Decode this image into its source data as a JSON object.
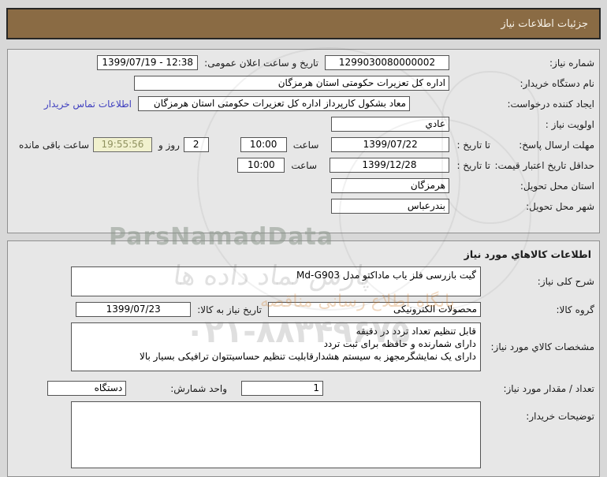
{
  "titlebar": {
    "title": "جزئیات اطلاعات نیاز"
  },
  "watermark": {
    "brand": "ParsNamadData",
    "calligraphy": "پارس نماد داده ها",
    "slogan": "پایگاه اطلاع رسانی مناقصه",
    "phone": "۰۲۱-۸۸۳۴۹۶۷۵"
  },
  "need_info": {
    "need_number": {
      "label": "شماره نیاز:",
      "value": "1299030080000002"
    },
    "announce_datetime": {
      "label": "تاریخ و ساعت اعلان عمومی:",
      "value": "1399/07/19 - 12:38"
    },
    "buyer_org": {
      "label": "نام دستگاه خریدار:",
      "value": "اداره کل تعزیرات حکومتی استان هرمزگان"
    },
    "request_creator": {
      "label": "ایجاد کننده درخواست:",
      "value": "معاد بشکول کارپرداز اداره کل تعزیرات حکومتی استان هرمزگان",
      "contact_link": "اطلاعات تماس خریدار"
    },
    "priority": {
      "label": "اولویت نیاز :",
      "value": "عادي"
    },
    "reply_deadline": {
      "label": "مهلت ارسال پاسخ:",
      "until_label": "تا تاریخ :",
      "date": "1399/07/22",
      "hour_label": "ساعت",
      "time": "10:00",
      "days_value": "2",
      "days_label": "روز و",
      "countdown": "19:55:56",
      "remaining_label": "ساعت باقی مانده"
    },
    "price_validity": {
      "label": "حداقل تاریخ اعتبار قیمت:",
      "until_label": "تا تاریخ :",
      "date": "1399/12/28",
      "hour_label": "ساعت",
      "time": "10:00"
    },
    "delivery_province": {
      "label": "استان محل تحویل:",
      "value": "هرمزگان"
    },
    "delivery_city": {
      "label": "شهر محل تحویل:",
      "value": "بندرعباس"
    }
  },
  "goods_info": {
    "section_title": "اطلاعات کالاهاي مورد نیاز",
    "general_desc": {
      "label": "شرح کلی نیاز:",
      "value": "گیت بازرسی فلز یاب ماداکتو مدل Md-G903"
    },
    "goods_group": {
      "label": "گروه کالا:",
      "value": "محصولات الکترونیکی"
    },
    "need_date": {
      "label": "تاریخ نیاز به کالا:",
      "value": "1399/07/23"
    },
    "specs": {
      "label": "مشخصات کالاي مورد نیاز:",
      "lines": [
        "قابل تنظیم تعداد تردد در دقیقه",
        "دارای شمارنده و حافظه برای ثبت تردد",
        "دارای یک نمایشگرمجهز به سیستم هشدارقابلیت تنظیم حساسیتتوان ترافیکی بسیار بالا"
      ]
    },
    "quantity": {
      "label": "تعداد / مقدار مورد نیاز:",
      "value": "1"
    },
    "unit": {
      "label": "واحد شمارش:",
      "value": "دستگاه"
    },
    "buyer_notes": {
      "label": "توضیحات خریدار:",
      "value": ""
    }
  }
}
